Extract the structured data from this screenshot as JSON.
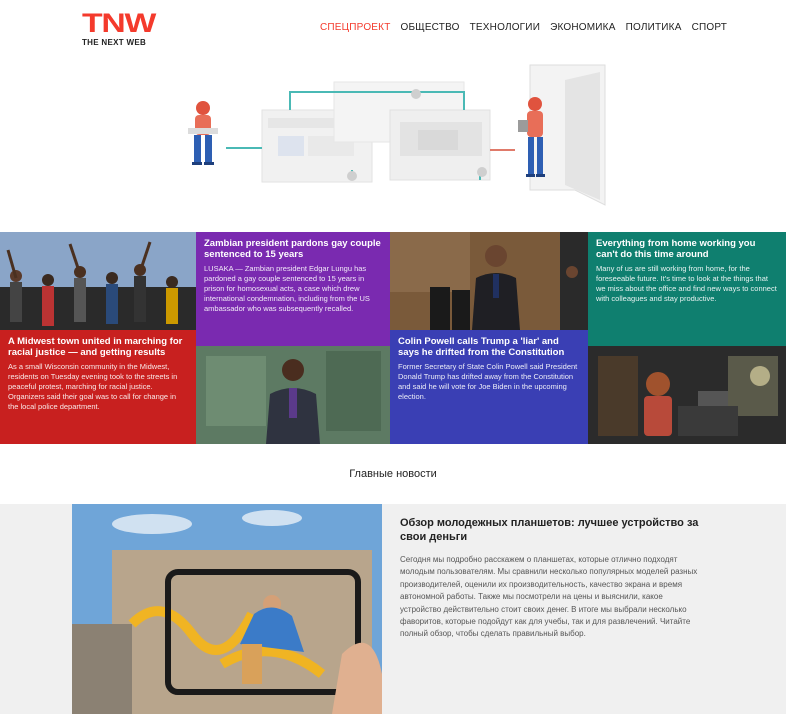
{
  "logo": {
    "mark": "TNW",
    "subtitle": "THE NEXT WEB"
  },
  "nav": [
    {
      "label": "Спецпроект",
      "active": true
    },
    {
      "label": "Общество",
      "active": false
    },
    {
      "label": "Технологии",
      "active": false
    },
    {
      "label": "Экономика",
      "active": false
    },
    {
      "label": "Политика",
      "active": false
    },
    {
      "label": "Спорт",
      "active": false
    }
  ],
  "tiles": [
    {
      "title": "A Midwest town united in marching for racial justice — and getting results",
      "body": "As a small Wisconsin community in the Midwest, residents on Tuesday evening took to the streets in peaceful protest, marching for racial justice. Organizers said their goal was to call for change in the local police department.",
      "color": "#c8201f"
    },
    {
      "title": "Zambian president pardons gay couple sentenced to 15 years",
      "body": "LUSAKA — Zambian president Edgar Lungu has pardoned a gay couple sentenced to 15 years in prison for homosexual acts, a case which drew international condemnation, including from the US ambassador who was subsequently recalled.",
      "color": "#7a2ab0"
    },
    {
      "title": "Colin Powell calls Trump a 'liar' and says he drifted from the Constitution",
      "body": "Former Secretary of State Colin Powell said President Donald Trump has drifted away from the Constitution and said he will vote for Joe Biden in the upcoming election.",
      "color": "#3a3fb4"
    },
    {
      "title": "Everything from home working you can't do this time around",
      "body": "Many of us are still working from home, for the foreseeable future. It's time to look at the things that we miss about the office and find new ways to connect with colleagues and stay productive.",
      "color": "#0f7f6f"
    }
  ],
  "section_title": "Главные новости",
  "featured": {
    "title": "Обзор молодежных планшетов: лучшее устройство за свои деньги",
    "body": "Сегодня мы подробно расскажем о планшетах, которые отлично подходят молодым пользователям. Мы сравнили несколько популярных моделей разных производителей, оценили их производительность, качество экрана и время автономной работы. Также мы посмотрели на цены и выяснили, какое устройство действительно стоит своих денег. В итоге мы выбрали несколько фаворитов, которые подойдут как для учебы, так и для развлечений. Читайте полный обзор, чтобы сделать правильный выбор."
  },
  "colors": {
    "accent": "#f43a2c",
    "red": "#c8201f",
    "purple": "#7a2ab0",
    "blue": "#3a3fb4",
    "teal": "#0f7f6f"
  }
}
